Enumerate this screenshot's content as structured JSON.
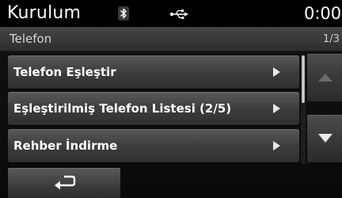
{
  "statusbar": {
    "title": "Kurulum",
    "clock": "0:00",
    "icons": [
      "bluetooth-icon",
      "usb-icon"
    ]
  },
  "header": {
    "section": "Telefon",
    "page": "1/3"
  },
  "menu": {
    "items": [
      {
        "label": "Telefon Eşleştir",
        "icon": "chevron-right-icon"
      },
      {
        "label": "Eşleştirilmiş Telefon Listesi (2/5)",
        "icon": "chevron-right-icon"
      },
      {
        "label": "Rehber İndirme",
        "icon": "chevron-right-icon"
      }
    ]
  },
  "controls": {
    "scroll_up_icon": "arrow-up-icon",
    "scroll_down_icon": "arrow-down-icon",
    "back_icon": "back-arrow-icon"
  },
  "colors": {
    "background": "#0a0a0a",
    "button_top": "#5a5a5a",
    "button_bottom": "#2f2f2f",
    "text": "#ffffff",
    "disabled_arrow": "#6b6b6b"
  }
}
